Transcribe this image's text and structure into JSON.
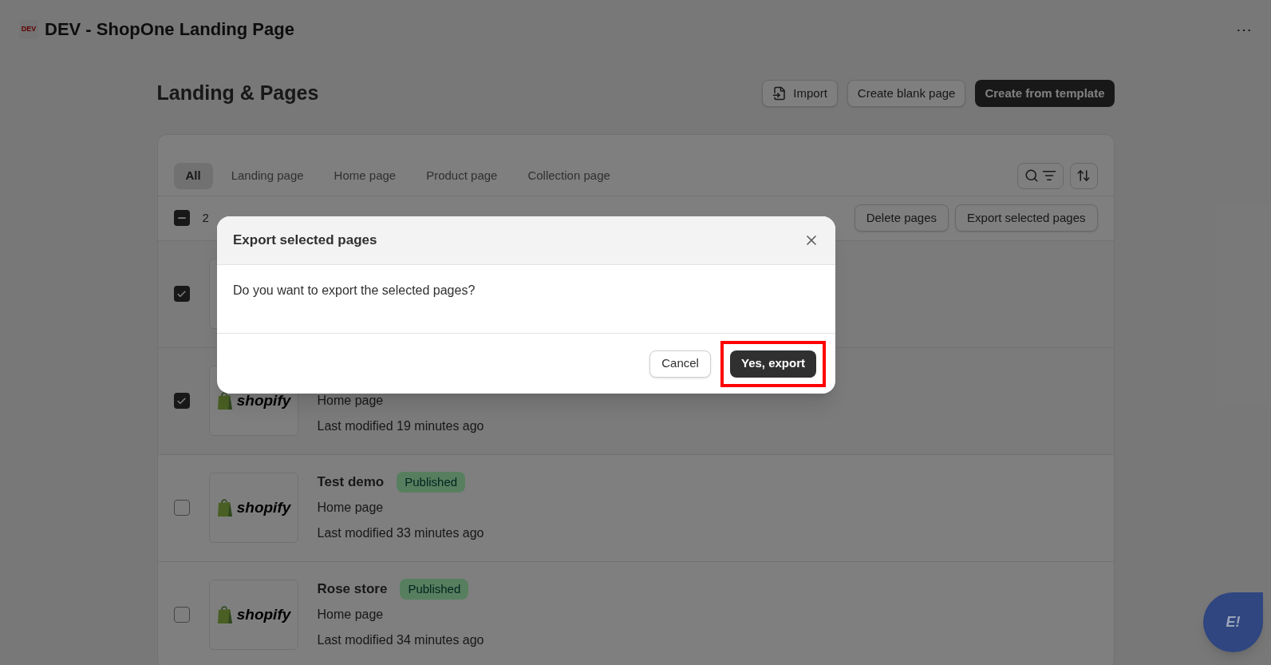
{
  "app": {
    "icon_text": "DEV",
    "title": "DEV - ShopOne Landing Page",
    "menu": "⋯"
  },
  "header": {
    "title": "Landing & Pages",
    "buttons": [
      {
        "kind": "import",
        "label": "Import"
      },
      {
        "kind": "secondary",
        "label": "Create blank page"
      },
      {
        "kind": "primary",
        "label": "Create from template"
      }
    ]
  },
  "tabs": [
    {
      "label": "All",
      "selected": true
    },
    {
      "label": "Landing page",
      "selected": false
    },
    {
      "label": "Home page",
      "selected": false
    },
    {
      "label": "Product page",
      "selected": false
    },
    {
      "label": "Collection page",
      "selected": false
    }
  ],
  "bulk_bar": {
    "select_all_checked": true,
    "select_all_indeterminate": true,
    "count": "2",
    "actions": [
      "Delete pages",
      "Export selected pages"
    ]
  },
  "rows": [
    {
      "checked": true
    },
    {
      "checked": true,
      "logo": "shopify",
      "type": "Home page",
      "modified": "Last modified 19 minutes ago"
    },
    {
      "checked": false,
      "logo": "shopify",
      "title": "Test demo",
      "status": "Published",
      "type": "Home page",
      "modified": "Last modified 33 minutes ago"
    },
    {
      "checked": false,
      "logo": "shopify",
      "title": "Rose store",
      "status": "Published",
      "type": "Home page",
      "modified": "Last modified 34 minutes ago"
    }
  ],
  "dialog": {
    "title": "Export selected pages",
    "message": "Do you want to export the selected pages?",
    "cancel": "Cancel",
    "confirm": "Yes, export",
    "confirm_highlighted": true
  },
  "chat_button": {
    "label": "E!"
  }
}
